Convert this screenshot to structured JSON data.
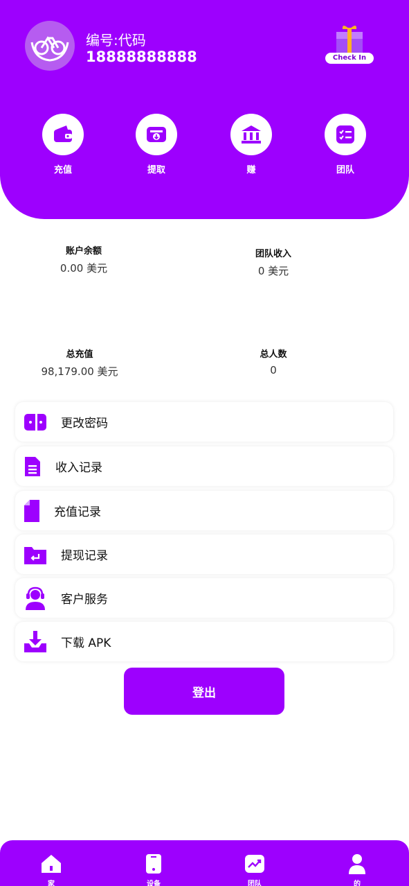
{
  "user": {
    "id_label": "编号:代码",
    "phone": "18888888888"
  },
  "checkin": {
    "label": "Check In"
  },
  "actions": [
    {
      "label": "充值",
      "icon": "wallet-icon"
    },
    {
      "label": "提取",
      "icon": "withdraw-icon"
    },
    {
      "label": "赚",
      "icon": "bank-icon"
    },
    {
      "label": "团队",
      "icon": "checklist-icon"
    }
  ],
  "stats": {
    "balance": {
      "label": "账户余额",
      "value": "0.00 美元"
    },
    "team_income": {
      "label": "团队收入",
      "value": "0 美元"
    },
    "total_recharge": {
      "label": "总充值",
      "value": "98,179.00 美元"
    },
    "total_people": {
      "label": "总人数",
      "value": "0"
    }
  },
  "menu": [
    {
      "label": "更改密码",
      "icon": "password-icon"
    },
    {
      "label": "收入记录",
      "icon": "document-icon"
    },
    {
      "label": "充值记录",
      "icon": "file-icon"
    },
    {
      "label": "提现记录",
      "icon": "folder-icon"
    },
    {
      "label": "客户服务",
      "icon": "support-agent-icon"
    },
    {
      "label": "下载 APK",
      "icon": "download-icon"
    }
  ],
  "logout_label": "登出",
  "nav": [
    {
      "label": "家",
      "icon": "home-icon"
    },
    {
      "label": "设备",
      "icon": "device-icon"
    },
    {
      "label": "团队",
      "icon": "chart-icon"
    },
    {
      "label": "的",
      "icon": "profile-icon"
    }
  ],
  "colors": {
    "brand": "#9d00fe",
    "white": "#ffffff"
  }
}
